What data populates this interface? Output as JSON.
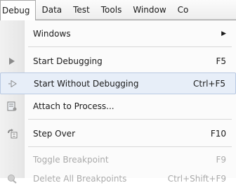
{
  "menubar": {
    "items": [
      {
        "label": "Debug"
      },
      {
        "label": "Data"
      },
      {
        "label": "Test"
      },
      {
        "label": "Tools"
      },
      {
        "label": "Window"
      },
      {
        "label": "Co"
      }
    ]
  },
  "menu": {
    "items": [
      {
        "label": "Windows",
        "shortcut": "",
        "icon": "none",
        "submenu_arrow": "▶",
        "disabled": false
      },
      {
        "label": "Start Debugging",
        "shortcut": "F5",
        "icon": "play-icon",
        "disabled": false
      },
      {
        "label": "Start Without Debugging",
        "shortcut": "Ctrl+F5",
        "icon": "play-outline-icon",
        "disabled": false,
        "highlighted": true
      },
      {
        "label": "Attach to Process...",
        "shortcut": "",
        "icon": "attach-process-icon",
        "disabled": false
      },
      {
        "label": "Step Over",
        "shortcut": "F10",
        "icon": "step-over-icon",
        "disabled": false
      },
      {
        "label": "Toggle Breakpoint",
        "shortcut": "F9",
        "icon": "none",
        "disabled": true
      },
      {
        "label": "Delete All Breakpoints",
        "shortcut": "Ctrl+Shift+F9",
        "icon": "delete-breakpoints-icon",
        "disabled": true
      }
    ]
  },
  "colors": {
    "highlight_bg": "#e7eef8",
    "highlight_border": "#b9c9e2",
    "disabled_text": "#aaaaaa"
  }
}
